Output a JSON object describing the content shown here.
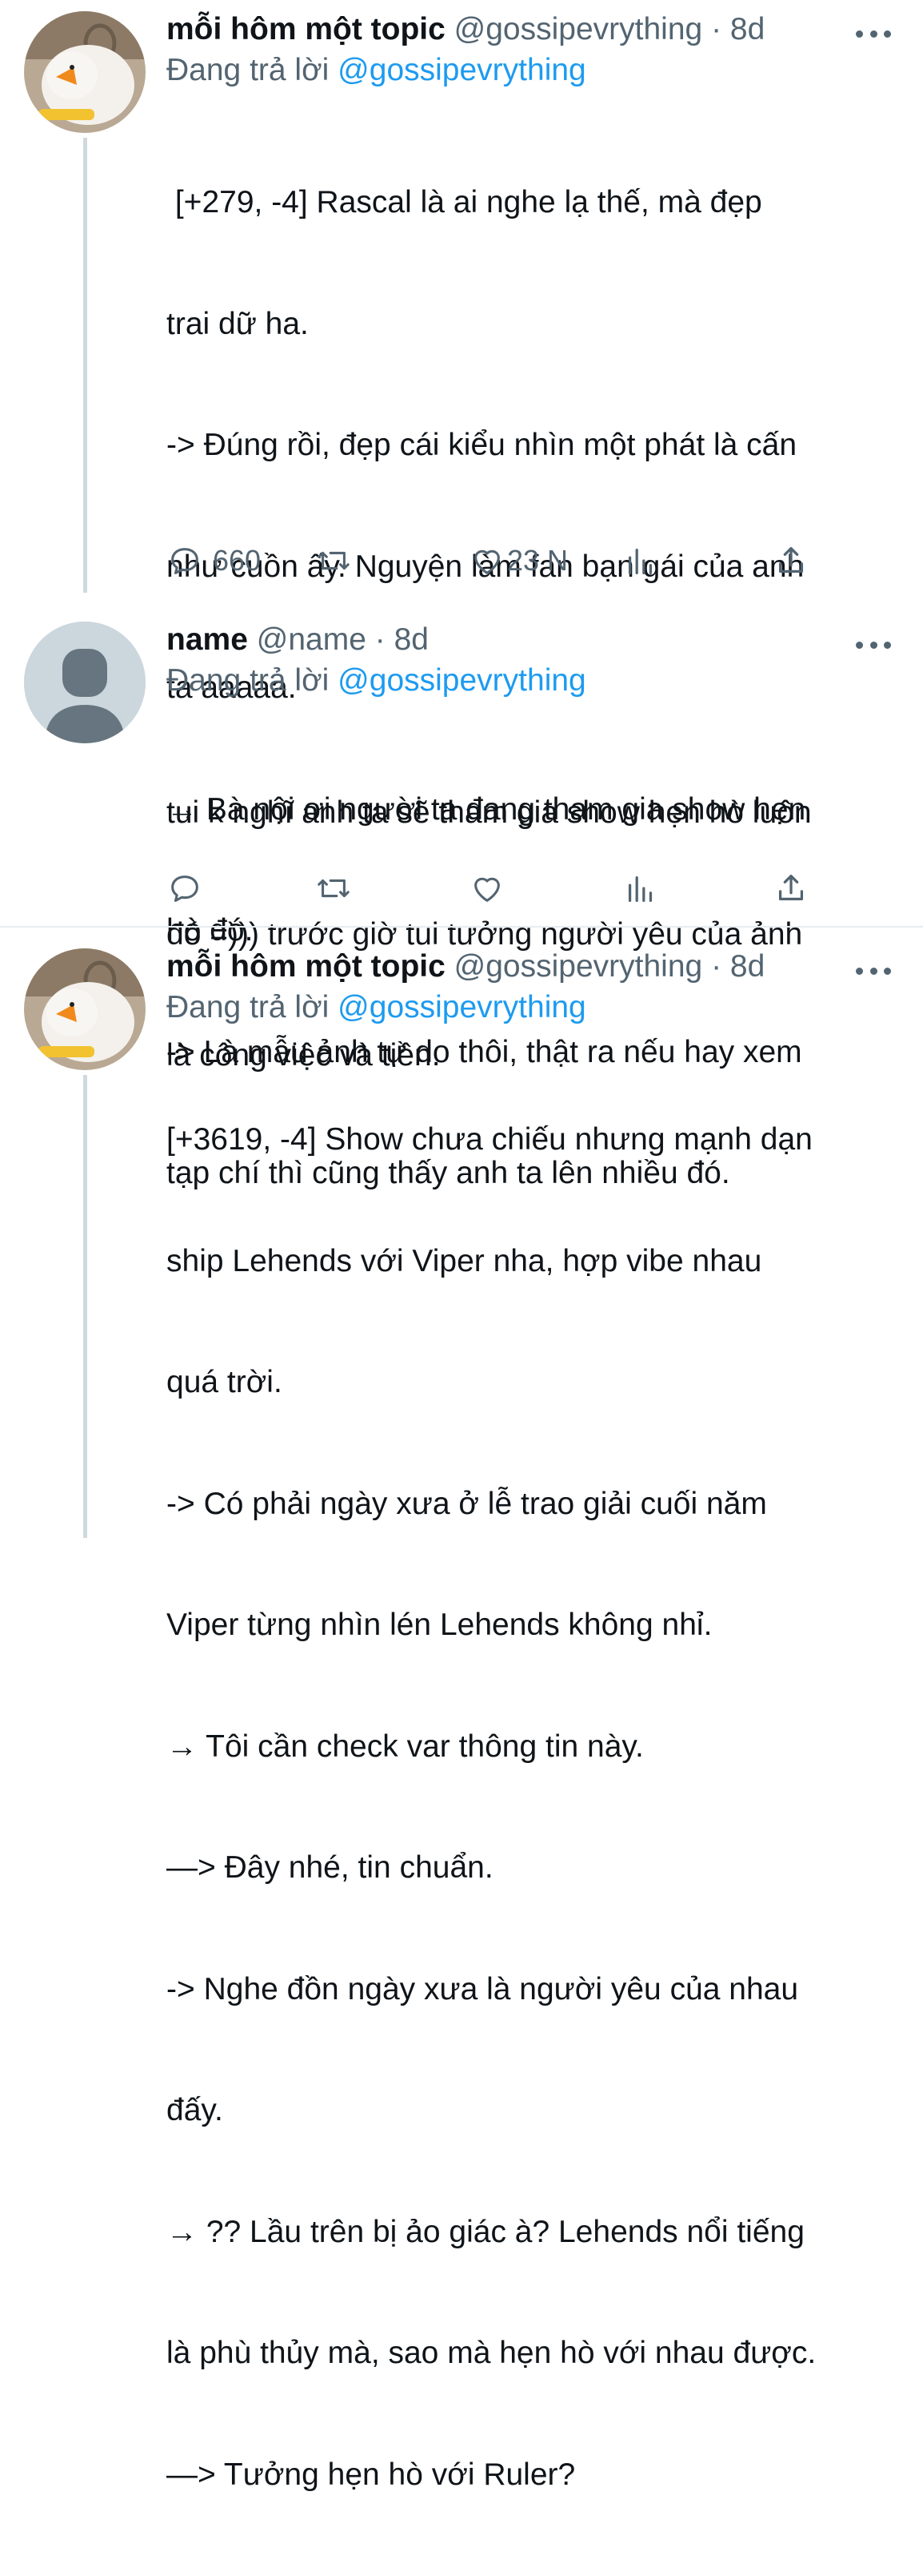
{
  "tweets": [
    {
      "author_name": "mỗi hôm một topic",
      "handle": "@gossipevrything",
      "time": "8d",
      "replying_prefix": "Đang trả lời ",
      "replying_to": "@gossipevrything",
      "lines": [
        " [+279, -4] Rascal là ai nghe lạ thế, mà đẹp",
        "trai dữ ha.",
        "-> Đúng rồi, đẹp cái kiểu nhìn một phát là cấn",
        "như cuồn ấy. Nguyện làm fan bạn gái của anh",
        "ta aaaaa.",
        "→ Bà nội ơi người ta đang tham gia show hẹn",
        "hò đó.",
        "-> Là mẫu ảnh tự do thôi, thật ra nếu hay xem",
        "tạp chí thì cũng thấy anh ta lên nhiều đó."
      ],
      "reply_count": "660",
      "retweet_count": "",
      "like_count": "23 N"
    },
    {
      "author_name": "name",
      "handle": "@name",
      "time": "8d",
      "replying_prefix": "Đang trả lời ",
      "replying_to": "@gossipevrything",
      "lines": [
        "tui k nghĩ anh ta sẽ tham gia show hẹn hò luôn",
        "đó =))) trước giờ tui tưởng người yêu của ảnh",
        "là công việc và tiền."
      ],
      "reply_count": "",
      "retweet_count": "",
      "like_count": ""
    },
    {
      "author_name": "mỗi hôm một topic",
      "handle": "@gossipevrything",
      "time": "8d",
      "replying_prefix": "Đang trả lời ",
      "replying_to": "@gossipevrything",
      "lines": [
        "[+3619, -4] Show chưa chiếu nhưng mạnh dạn",
        "ship Lehends với Viper nha, hợp vibe nhau",
        "quá trời.",
        "-> Có phải ngày xưa ở lễ trao giải cuối năm",
        "Viper từng nhìn lén Lehends không nhỉ.",
        "→ Tôi cần check var thông tin này.",
        "—> Đây nhé, tin chuẩn.",
        "-> Nghe đồn ngày xưa là người yêu của nhau",
        "đấy.",
        "→ ?? Lầu trên bị ảo giác à? Lehends nổi tiếng",
        "là phù thủy mà, sao mà hẹn hò với nhau được.",
        "—> Tưởng hẹn hò với Ruler?"
      ]
    }
  ],
  "separator": " · ",
  "colors": {
    "accent": "#1d9bf0",
    "muted": "#536471",
    "line": "#cfd9de"
  },
  "icons": [
    "reply-icon",
    "retweet-icon",
    "like-icon",
    "views-icon",
    "share-icon",
    "more-icon"
  ]
}
